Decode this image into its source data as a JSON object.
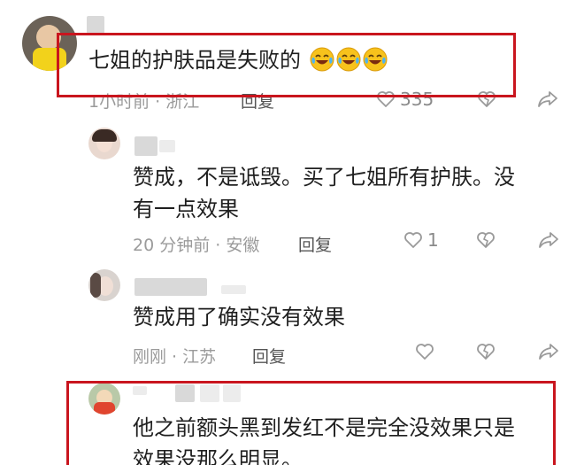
{
  "comments": [
    {
      "text": "七姐的护肤品是失败的",
      "emoji_icon": "tears-of-joy-emoji",
      "emoji_count": 3,
      "time": "1小时前",
      "location": "浙江",
      "reply_label": "回复",
      "like_count": "335"
    },
    {
      "text_line1": "赞成，不是诋毁。买了七姐所有护肤。没",
      "text_line2": "有一点效果",
      "meta": "20 分钟前 · 安徽",
      "reply_label": "回复",
      "like_count": "1"
    },
    {
      "text": "赞成用了确实没有效果",
      "meta": "刚刚 · 江苏",
      "reply_label": "回复"
    },
    {
      "text_line1": "他之前额头黑到发红不是完全没效果只是",
      "text_line2": "效果没那么明显。"
    }
  ],
  "icons": {
    "like": "heart-outline-icon",
    "dislike": "broken-heart-icon",
    "share": "share-arrow-icon"
  },
  "colors": {
    "highlight": "#c9151e",
    "meta": "#9b9b9b",
    "text": "#1f1f1f"
  }
}
